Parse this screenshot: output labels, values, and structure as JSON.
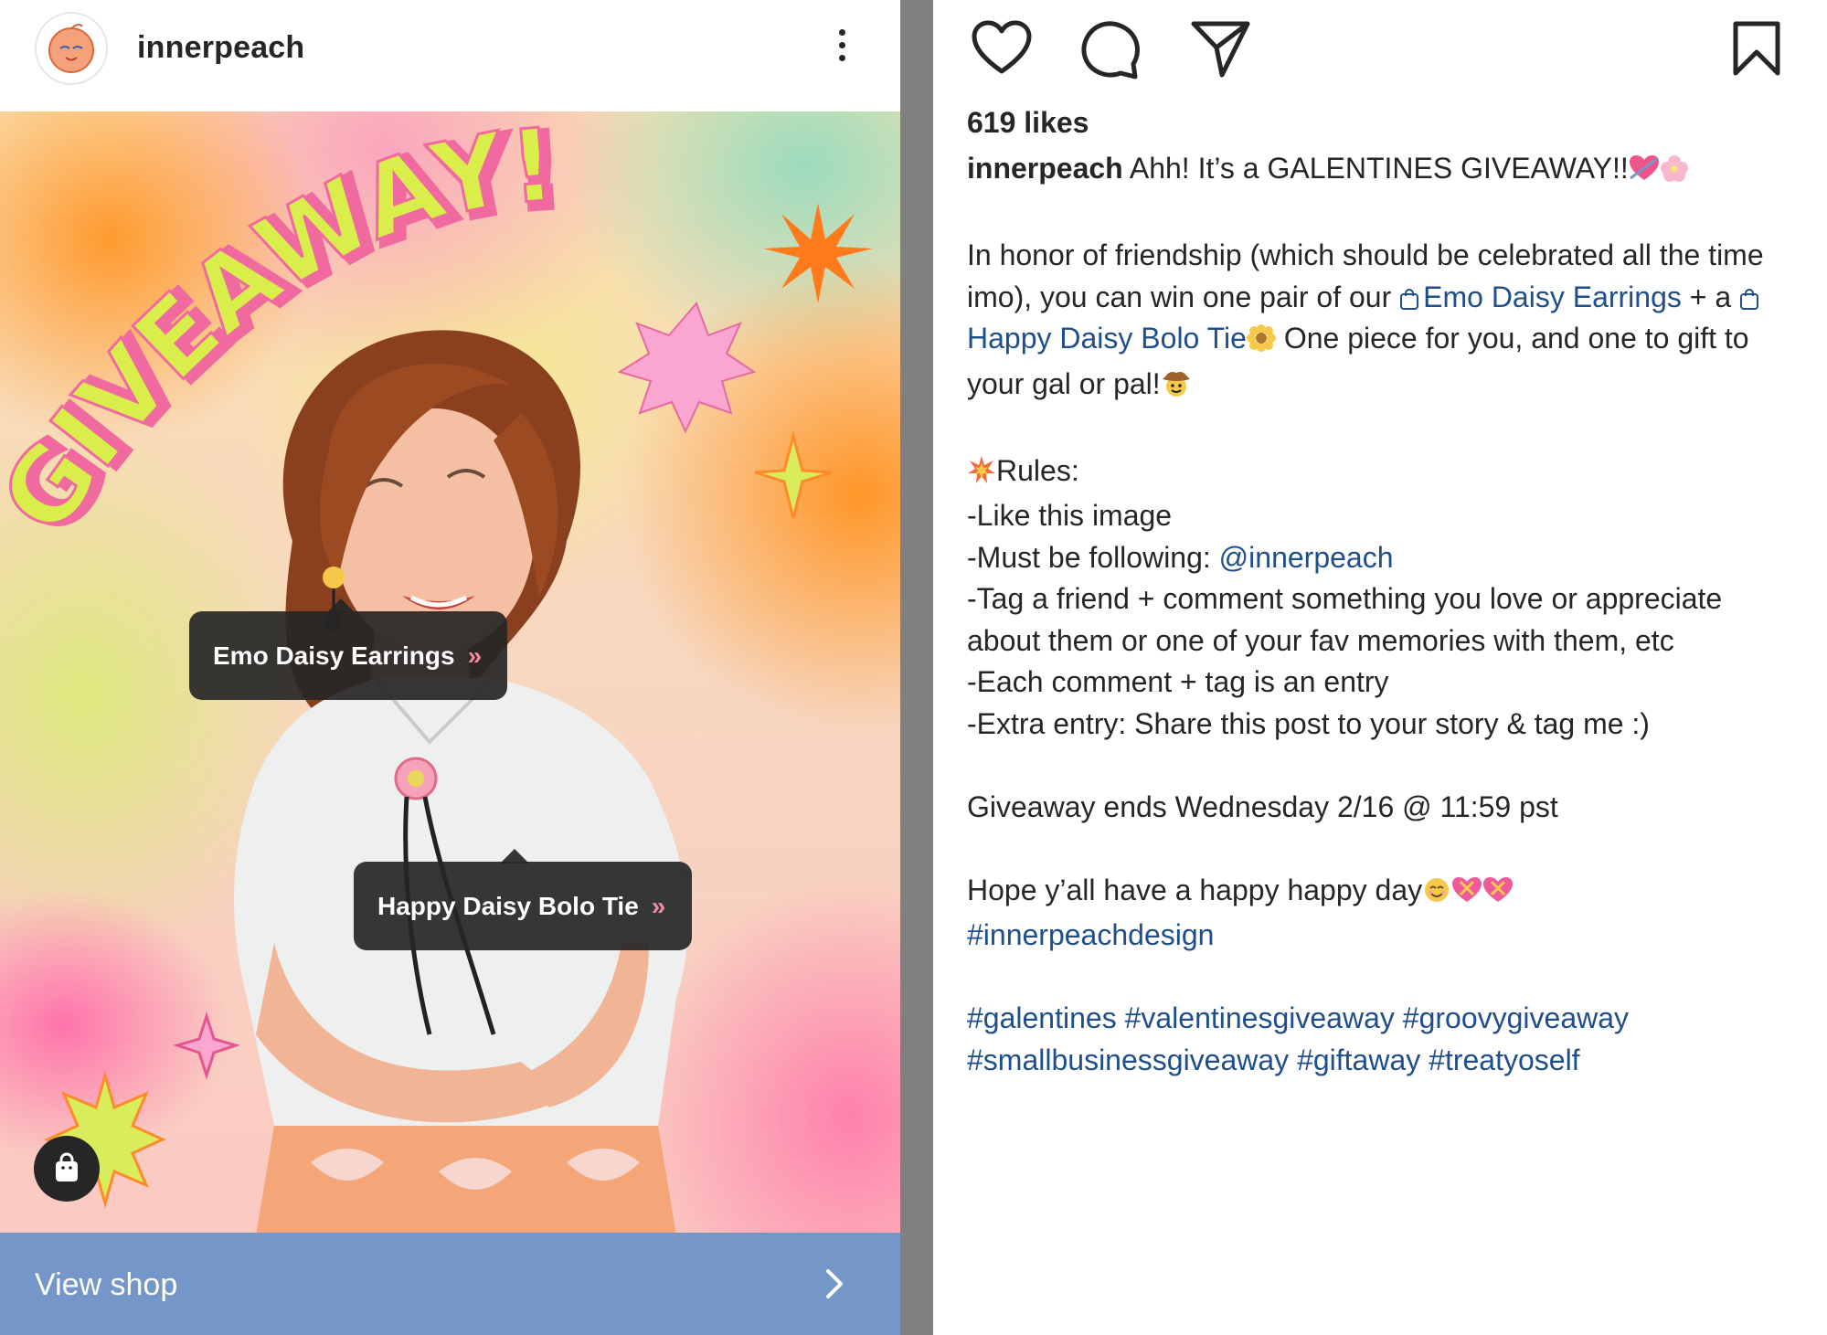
{
  "post": {
    "username": "innerpeach",
    "image": {
      "headline": "GIVEAWAY!",
      "tags": [
        {
          "label": "Emo Daisy Earrings"
        },
        {
          "label": "Happy Daisy Bolo Tie"
        }
      ]
    },
    "view_shop_label": "View shop"
  },
  "actions": {
    "like_icon": "heart-icon",
    "comment_icon": "comment-bubble-icon",
    "share_icon": "paper-plane-icon",
    "save_icon": "bookmark-icon"
  },
  "likes": "619 likes",
  "caption": {
    "username": "innerpeach",
    "first_line": "Ahh! It’s a GALENTINES GIVEAWAY!!",
    "honor_text_1": "In honor of friendship (which should be celebrated all the time imo), you can win one pair of our",
    "product_link_1": "Emo Daisy Earrings",
    "plus_a": "+ a",
    "product_link_2": "Happy Daisy Bolo Tie",
    "honor_text_2": "One piece for you, and one to gift to your gal or pal!",
    "rules_title": "Rules:",
    "rule_1": "-Like this image",
    "rule_2_prefix": "-Must be following:",
    "rule_2_mention": "@innerpeach",
    "rule_3": "-Tag a friend + comment something you love or appreciate about them or one of your fav memories with them, etc",
    "rule_4": "-Each comment + tag is an entry",
    "rule_5": "-Extra entry: Share this post to your story & tag me :)",
    "ends": "Giveaway ends Wednesday 2/16 @ 11:59 pst",
    "closing": "Hope y’all have a happy happy day",
    "hashtag_main": "#innerpeachdesign",
    "hashtags_1": "#galentines #valentinesgiveaway #groovygiveaway",
    "hashtags_2": "#smallbusinessgiveaway #giftaway #treatyoself"
  },
  "colors": {
    "link": "#1f4e8c",
    "view_shop_bg": "#7596c9",
    "tag_bg": "#262626",
    "divider": "#808080"
  }
}
